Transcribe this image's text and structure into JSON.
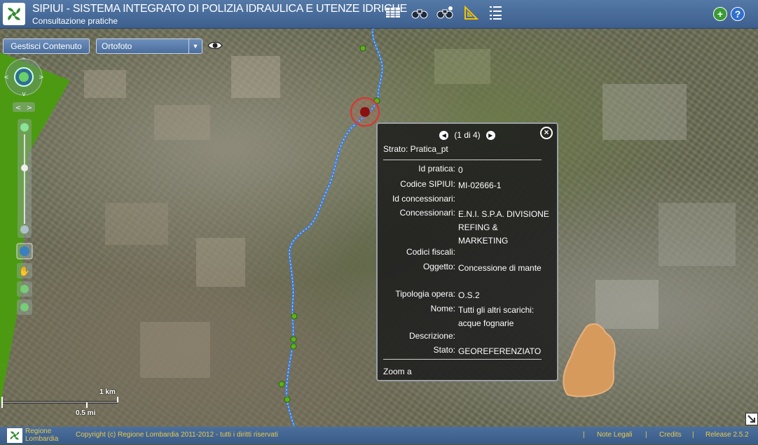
{
  "header": {
    "title": "SIPIUI - SISTEMA INTEGRATO DI POLIZIA IDRAULICA E UTENZE IDRICHE",
    "subtitle": "Consultazione pratiche",
    "tools": [
      "table-icon",
      "binoculars-icon",
      "binoculars-gear-icon",
      "ruler-triangle-icon",
      "list-icon"
    ],
    "right_buttons": [
      "add-icon",
      "help-icon"
    ]
  },
  "toolbar": {
    "content_button": "Gestisci Contenuto",
    "basemap_selected": "Ortofoto"
  },
  "popup": {
    "pager": "(1 di 4)",
    "layer": "Strato: Pratica_pt",
    "fields": [
      {
        "label": "Id pratica:",
        "value": "0"
      },
      {
        "label": "Codice SIPIUI:",
        "value": "MI-02666-1"
      },
      {
        "label": "Id concessionari:",
        "value": ""
      },
      {
        "label": "Concessionari:",
        "value": "E.N.I. S.P.A. DIVISIONE REFING & MARKETING"
      },
      {
        "label": "Codici fiscali:",
        "value": ""
      },
      {
        "label": "Oggetto:",
        "value": "Concessione di mante"
      },
      {
        "label": "Tipologia opera:",
        "value": "O.S.2"
      },
      {
        "label": "Nome:",
        "value": "Tutti gli altri scarichi: acque fognarie"
      },
      {
        "label": "Descrizione:",
        "value": ""
      },
      {
        "label": "Stato:",
        "value": "GEOREFERENZIATO"
      }
    ],
    "zoom_link": "Zoom a"
  },
  "scale": {
    "km": "1 km",
    "mi": "0.5 mi"
  },
  "footer": {
    "logo_line1": "Regione",
    "logo_line2": "Lombardia",
    "copyright": "Copyright (c) Regione Lombardia 2011-2012 - tutti i diritti riservati",
    "sep": "|",
    "legal": "Note Legali",
    "credits": "Credits",
    "release": "Release 2.5.2"
  },
  "colors": {
    "header": "#4a6e9c",
    "accent_text": "#e8c94a",
    "river": "#3a7de0",
    "green_area": "#4c9a12",
    "orange_area": "#d59a5c",
    "selected_marker": "#8b1010"
  }
}
